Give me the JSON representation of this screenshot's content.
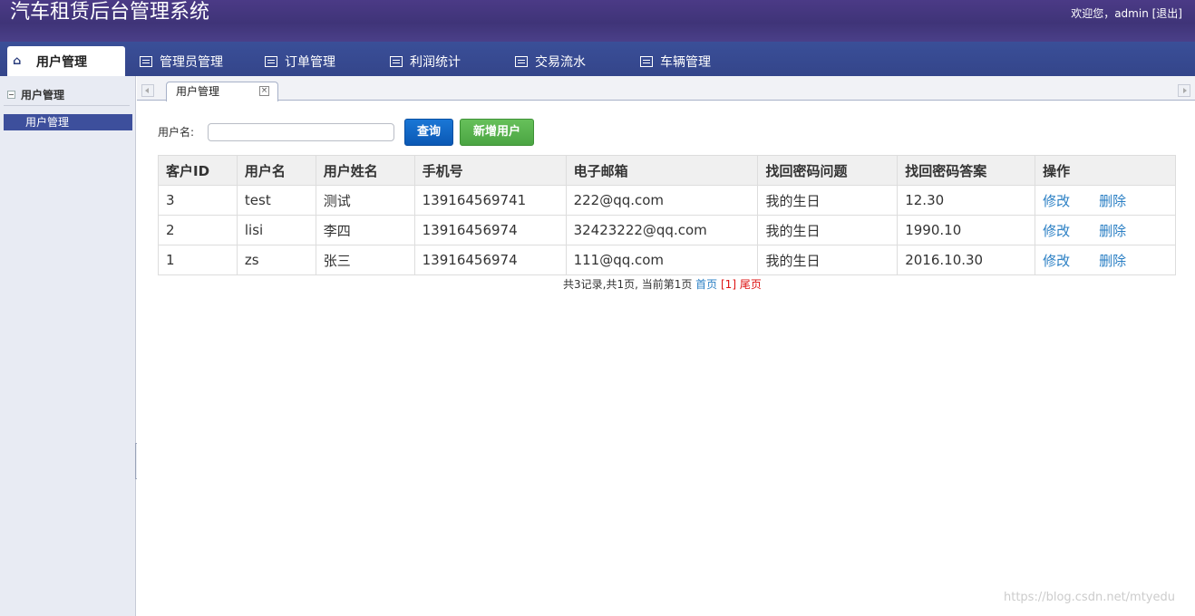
{
  "header": {
    "title": "汽车租赁后台管理系统",
    "user_prefix": "欢迎您，admin ",
    "logout": "[退出]"
  },
  "nav": {
    "items": [
      {
        "label": "用户管理",
        "icon": "home-icon",
        "active": true
      },
      {
        "label": "管理员管理",
        "icon": "list-icon"
      },
      {
        "label": "订单管理",
        "icon": "list-icon"
      },
      {
        "label": "利润统计",
        "icon": "list-icon"
      },
      {
        "label": "交易流水",
        "icon": "list-icon"
      },
      {
        "label": "车辆管理",
        "icon": "list-icon"
      }
    ]
  },
  "sidebar": {
    "section": "用户管理",
    "items": [
      {
        "label": "用户管理",
        "selected": true
      }
    ]
  },
  "tabs": {
    "open": [
      {
        "label": "用户管理",
        "close": "×"
      }
    ]
  },
  "search": {
    "label": "用户名:",
    "value": "",
    "query_button": "查询",
    "add_button": "新增用户"
  },
  "table": {
    "columns": [
      "客户ID",
      "用户名",
      "用户姓名",
      "手机号",
      "电子邮箱",
      "找回密码问题",
      "找回密码答案",
      "操作"
    ],
    "rows": [
      {
        "id": "3",
        "username": "test",
        "name": "测试",
        "phone": "139164569741",
        "email": "222@qq.com",
        "question": "我的生日",
        "answer": "12.30",
        "edit": "修改",
        "delete": "删除"
      },
      {
        "id": "2",
        "username": "lisi",
        "name": "李四",
        "phone": "13916456974",
        "email": "32423222@qq.com",
        "question": "我的生日",
        "answer": "1990.10",
        "edit": "修改",
        "delete": "删除"
      },
      {
        "id": "1",
        "username": "zs",
        "name": "张三",
        "phone": "13916456974",
        "email": "111@qq.com",
        "question": "我的生日",
        "answer": "2016.10.30",
        "edit": "修改",
        "delete": "删除"
      }
    ]
  },
  "pagination": {
    "summary": "共3记录,共1页, 当前第1页 ",
    "first": "首页",
    "current": " [1] ",
    "last": "尾页"
  },
  "watermark": "https://blog.csdn.net/mtyedu",
  "colors": {
    "header_bg": "#4b3a86",
    "nav_bg": "#3a4f98",
    "sidebar_bg": "#e8ebf3",
    "selected_item": "#3d4f9c",
    "query_btn": "#0b58b4",
    "add_btn": "#4ba543",
    "link": "#2a7fc4",
    "current_page": "#dd1111"
  }
}
